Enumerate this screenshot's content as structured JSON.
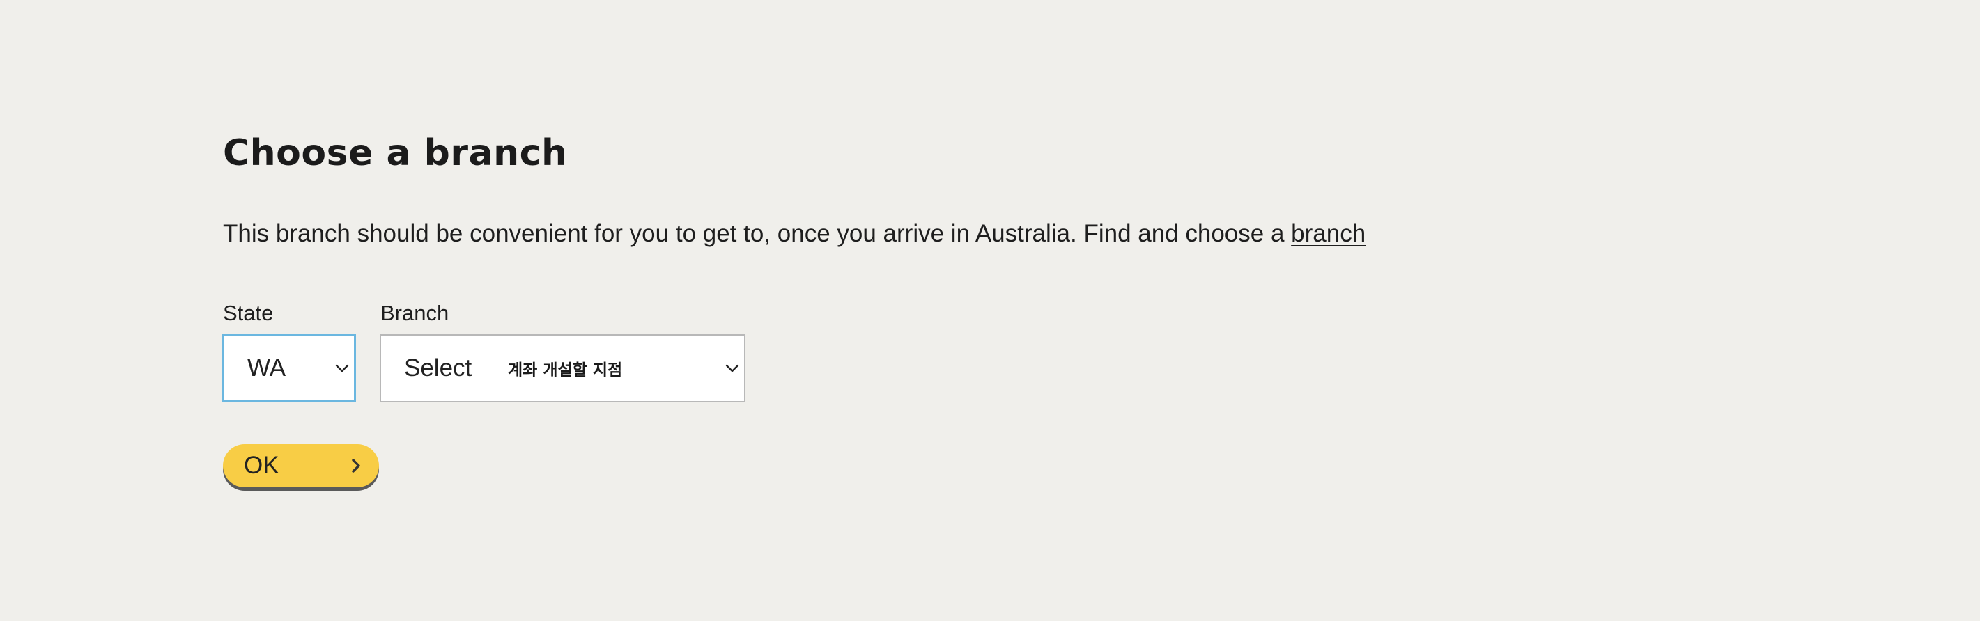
{
  "page": {
    "title": "Choose a branch",
    "intro_text": "This branch should be convenient for you to get to, once you arrive in Australia. Find and choose a ",
    "intro_link": "branch"
  },
  "form": {
    "state": {
      "label": "State",
      "selected": "WA",
      "icon": "chevron-down-icon"
    },
    "branch": {
      "label": "Branch",
      "selected": "Select",
      "hint": "계좌 개설할 지점",
      "icon": "chevron-down-icon"
    },
    "ok_button": {
      "label": "OK",
      "icon": "chevron-right-icon"
    }
  },
  "colors": {
    "background": "#f0efeb",
    "focus_border": "#6bb7e0",
    "button_fill": "#f8cd45",
    "button_shadow": "#5a5a5a",
    "text": "#1e1e1e"
  }
}
